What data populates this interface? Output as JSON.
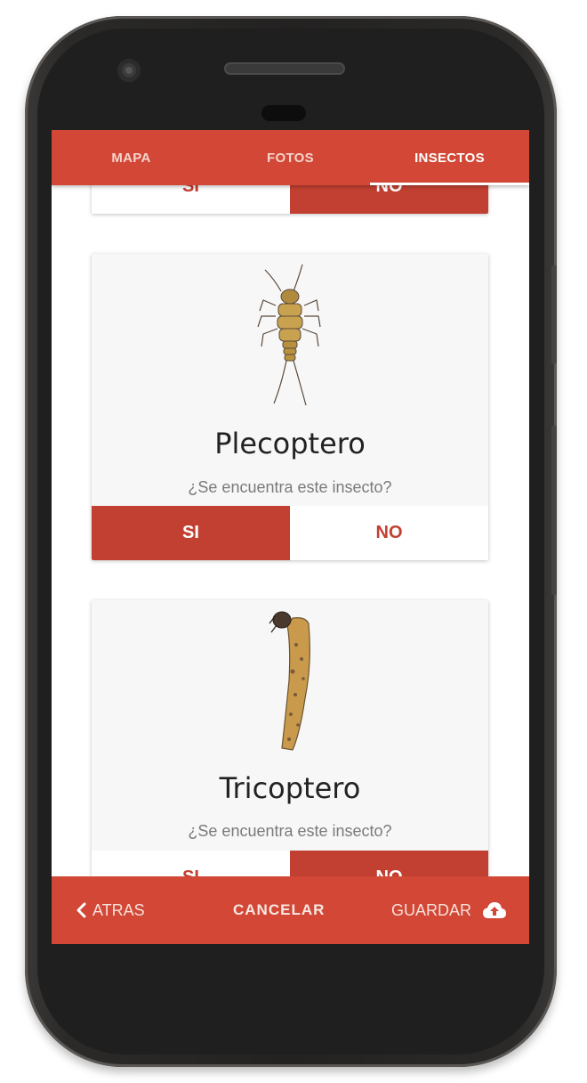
{
  "tabs": [
    {
      "label": "MAPA",
      "active": false
    },
    {
      "label": "FOTOS",
      "active": false
    },
    {
      "label": "INSECTOS",
      "active": true
    }
  ],
  "cards": [
    {
      "title": "",
      "question": "",
      "yes_label": "SI",
      "no_label": "NO",
      "selected": "no"
    },
    {
      "title": "Plecoptero",
      "question": "¿Se encuentra este insecto?",
      "yes_label": "SI",
      "no_label": "NO",
      "selected": "si"
    },
    {
      "title": "Tricoptero",
      "question": "¿Se encuentra este insecto?",
      "yes_label": "SI",
      "no_label": "NO",
      "selected": "no"
    }
  ],
  "bottom_bar": {
    "back_label": "ATRAS",
    "cancel_label": "CANCELAR",
    "save_label": "GUARDAR"
  },
  "icons": {
    "back": "chevron-left-icon",
    "save": "cloud-upload-icon"
  },
  "colors": {
    "primary": "#d24735",
    "selected_button": "#c24031",
    "card_background": "#f7f7f7"
  }
}
